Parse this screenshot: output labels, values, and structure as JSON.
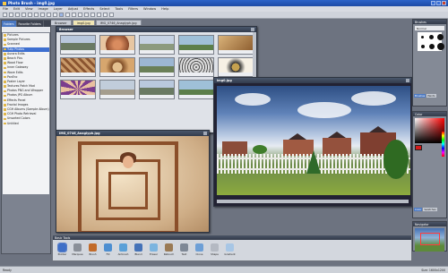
{
  "app": {
    "title": "Photo Brush - img0.jpg",
    "menu": [
      "File",
      "Edit",
      "View",
      "Image",
      "Layer",
      "Adjust",
      "Effects",
      "Select",
      "Tools",
      "Filters",
      "Window",
      "Help"
    ]
  },
  "doc_tabs": [
    "Browser",
    "img0.jpg",
    "IMG_0746_Anaglyph.jpg"
  ],
  "left_panel": {
    "tabs": [
      "Folders",
      "Favorite Folders"
    ],
    "path": "",
    "folders": [
      "Pictures",
      "Sample Pictures",
      "Scanned",
      "Tulip Photos",
      "Aurora Edits",
      "Beach Pics",
      "Wood Floor",
      "Inner Gateway",
      "Wave Edits",
      "PanEnc",
      "Poster Layer",
      "Textures Patch Mod",
      "Photos PNG and Wrapper",
      "Photos JPG Album",
      "Effects Panel",
      "Fractal Images",
      "CGH Albums (Sample Album)",
      "CGH Photo Retrieval",
      "Unsorted Colors",
      "Untitled"
    ],
    "selected_index": 3
  },
  "browser": {
    "title": "Browser"
  },
  "tunnel_window": {
    "title": "IMG_0746_Anaglyph.jpg"
  },
  "house_window": {
    "title": "img0.jpg"
  },
  "right_panel": {
    "brushes_title": "Brushes",
    "brush_select": "Normal",
    "mid_tabs": [
      "Brushes",
      "Paints"
    ],
    "color_title": "Color",
    "color_tabs": [
      "Color",
      "Swatches"
    ],
    "navigator_title": "Navigator"
  },
  "tools": {
    "title": "Basic Tools",
    "items": [
      "Pointer",
      "Marquee",
      "Brush",
      "Fill",
      "Airbrush",
      "Blend",
      "Eraser",
      "Retouch",
      "Text",
      "Clone",
      "Shape",
      "Gradient"
    ],
    "selected_index": 0,
    "colors": [
      "#3f6fc7",
      "#8a8f98",
      "#c26b2a",
      "#4c8ed1",
      "#5aa0d8",
      "#4472b8",
      "#7bb4df",
      "#9a7a55",
      "#7e8896",
      "#6d9fd6",
      "#b4b9c2",
      "#a7c6e5"
    ]
  },
  "status": {
    "left": "Ready",
    "right": "Size: 1600x1200"
  }
}
